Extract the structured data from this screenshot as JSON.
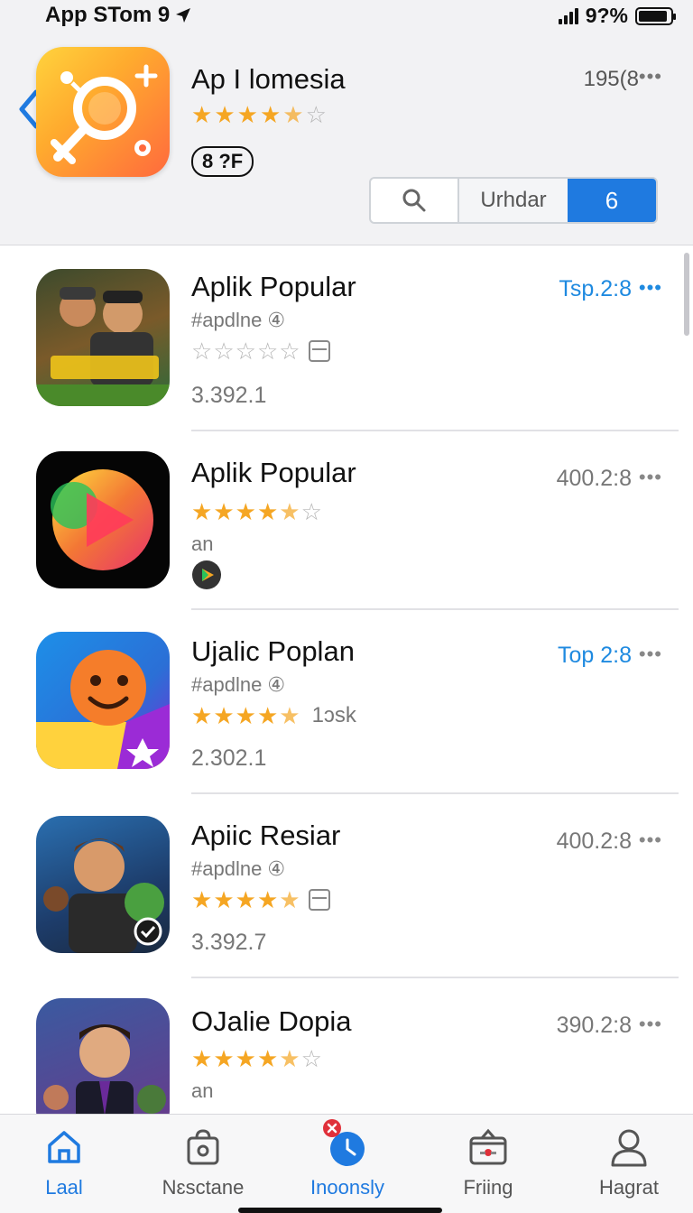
{
  "status_bar": {
    "carrier": "App STom 9",
    "battery_text": "9?%",
    "battery_level": 0.92
  },
  "header": {
    "app_title": "Ap I lomesia",
    "rating": 4.5,
    "badge": "8 ?F",
    "count": "195(8",
    "segmented": {
      "update_label": "Urhdar",
      "count_label": "6"
    }
  },
  "apps": [
    {
      "title": "Aplik Popular",
      "meta": "#apdlne ④",
      "rating": 0,
      "version": "3.392.1",
      "price": "Tsp.2:8",
      "price_color": "#1f8ae0",
      "icon": "soldier-game-icon"
    },
    {
      "title": "Aplik Popular",
      "meta": "an",
      "rating": 4.5,
      "version": "",
      "price": "400.2:8",
      "price_color": "#777777",
      "icon": "play-store-icon"
    },
    {
      "title": "Ujalic Poplan",
      "meta": "#apdlne ④",
      "rating": 4.5,
      "extra": "1ɔsk",
      "version": "2.302.1",
      "price": "Top 2:8",
      "price_color": "#1f8ae0",
      "icon": "smiley-game-icon"
    },
    {
      "title": "Apiic Resiar",
      "meta": "#apdlne ④",
      "rating": 4.5,
      "version": "3.392.7",
      "price": "400.2:8",
      "price_color": "#777777",
      "icon": "hero-game-icon"
    },
    {
      "title": "OJalie Dopia",
      "meta": "an",
      "rating": 4.5,
      "version": "",
      "price": "390.2:8",
      "price_color": "#777777",
      "icon": "businessman-game-icon"
    }
  ],
  "tabs": [
    {
      "label": "Laal",
      "icon": "home-icon",
      "active": true
    },
    {
      "label": "Nɛsctane",
      "icon": "bag-icon",
      "active": false
    },
    {
      "label": "Inoonsly",
      "icon": "clock-icon",
      "active": false
    },
    {
      "label": "Friing",
      "icon": "gift-box-icon",
      "active": false
    },
    {
      "label": "Hagrat",
      "icon": "person-icon",
      "active": false
    }
  ],
  "colors": {
    "accent": "#1f7ae0",
    "star": "#f5a623",
    "header_bg": "#f2f2f4"
  }
}
